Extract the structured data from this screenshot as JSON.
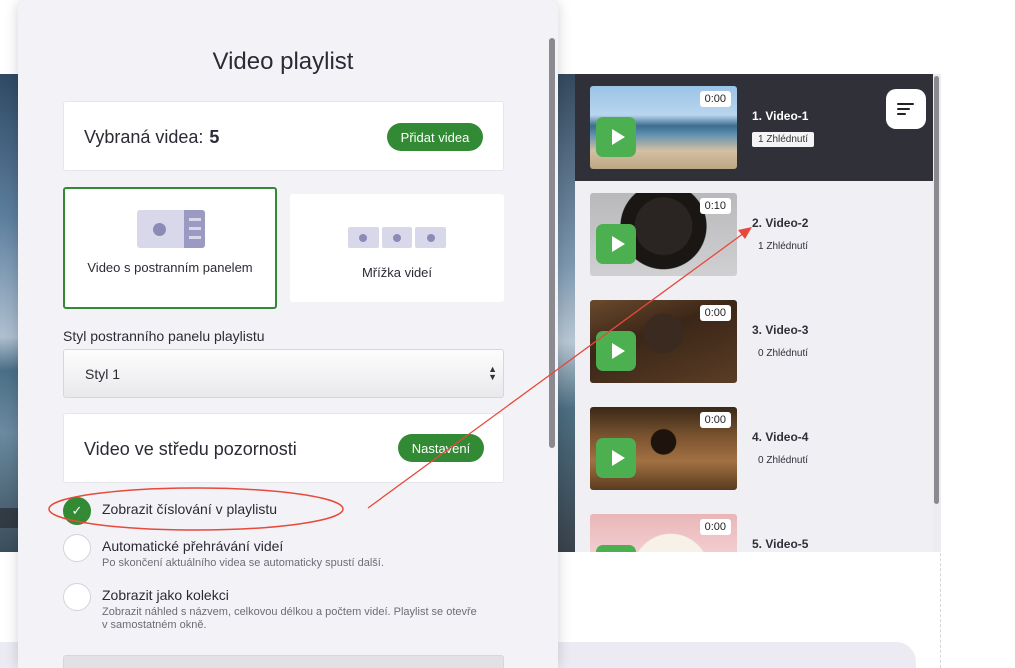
{
  "panel": {
    "title": "Video playlist",
    "selected_videos": {
      "label": "Vybraná videa:",
      "count": "5",
      "add_button": "Přidat videa"
    },
    "layouts": [
      {
        "label": "Video s postranním panelem",
        "selected": true
      },
      {
        "label": "Mřížka videí",
        "selected": false
      }
    ],
    "sidebar_style": {
      "label": "Styl postranního panelu playlistu",
      "value": "Styl 1"
    },
    "spotlight": {
      "label": "Video ve středu pozornosti",
      "button": "Nastavení"
    },
    "options": [
      {
        "title": "Zobrazit číslování v playlistu",
        "subtitle": "",
        "checked": true
      },
      {
        "title": "Automatické přehrávání videí",
        "subtitle": "Po skončení aktuálního videa se automaticky spustí další.",
        "checked": false
      },
      {
        "title": "Zobrazit jako kolekci",
        "subtitle": "Zobrazit náhled s názvem, celkovou délkou a počtem videí. Playlist se otevře v samostatném okně.",
        "checked": false
      }
    ]
  },
  "playlist": {
    "items": [
      {
        "title": "1. Video-1",
        "views": "1 Zhlédnutí",
        "duration": "0:00",
        "active": true
      },
      {
        "title": "2. Video-2",
        "views": "1 Zhlédnutí",
        "duration": "0:10",
        "active": false
      },
      {
        "title": "3. Video-3",
        "views": "0 Zhlédnutí",
        "duration": "0:00",
        "active": false
      },
      {
        "title": "4. Video-4",
        "views": "0 Zhlédnutí",
        "duration": "0:00",
        "active": false
      },
      {
        "title": "5. Video-5",
        "views": "",
        "duration": "0:00",
        "active": false
      }
    ]
  },
  "colors": {
    "accent_green": "#338a35",
    "play_green": "#4caf50",
    "annotation_red": "#e8493a",
    "active_item_bg": "#2f3038"
  },
  "icons": {
    "menu": "sort-lines-icon",
    "play": "play-icon",
    "check": "check-icon"
  }
}
